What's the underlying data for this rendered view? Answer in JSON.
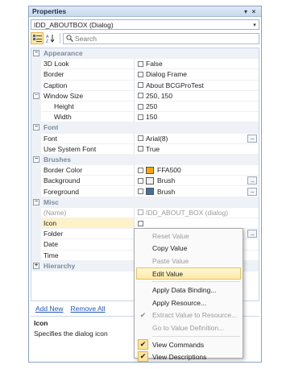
{
  "window": {
    "title": "Properties",
    "pin_glyph": "▾",
    "close_glyph": "×"
  },
  "object_combo": {
    "value": "IDD_ABOUTBOX (Dialog)",
    "arrow": "▾"
  },
  "toolbar": {
    "categorized_glyph": "☷",
    "alphabetical_glyph": "↓",
    "search_placeholder": "Search"
  },
  "grid": {
    "appearance": "Appearance",
    "look3d": {
      "name": "3D Look",
      "value": "False"
    },
    "border": {
      "name": "Border",
      "value": "Dialog Frame"
    },
    "caption": {
      "name": "Caption",
      "value": "About BCGProTest"
    },
    "window_size": {
      "name": "Window Size",
      "value": "250, 150"
    },
    "height": {
      "name": "Height",
      "value": "250"
    },
    "width": {
      "name": "Width",
      "value": "150"
    },
    "font_cat": "Font",
    "font": {
      "name": "Font",
      "value": "Arial(8)"
    },
    "use_system_font": {
      "name": "Use System Font",
      "value": "True"
    },
    "brushes": "Brushes",
    "border_color": {
      "name": "Border Color",
      "value": "FFA500",
      "color": "#FFA500"
    },
    "background": {
      "name": "Background",
      "value": "Brush",
      "color": "#F2F2F2"
    },
    "foreground": {
      "name": "Foreground",
      "value": "Brush",
      "color": "#3F6FA6"
    },
    "misc": "Misc",
    "name_prop": {
      "name": "(Name)",
      "value": "IDD_ABOUT_BOX (dialog)"
    },
    "icon": {
      "name": "Icon"
    },
    "folder": {
      "name": "Folder"
    },
    "date": {
      "name": "Date"
    },
    "time": {
      "name": "Time"
    },
    "hierarchy": "Hierarchy",
    "ellipsis": "..."
  },
  "links": {
    "add_new": "Add New",
    "remove_all": "Remove All"
  },
  "description": {
    "title": "Icon",
    "text": "Specifies the dialog icon"
  },
  "context_menu": {
    "reset_value": "Reset Value",
    "copy_value": "Copy Value",
    "paste_value": "Paste Value",
    "edit_value": "Edit Value",
    "apply_data_binding": "Apply Data Binding...",
    "apply_resource": "Apply Resource...",
    "extract_value": "Extract Value to Resource...",
    "go_to_value_definition": "Go to Value Definition...",
    "view_commands": "View Commands",
    "view_descriptions": "View Descriptions",
    "check_glyph": "✔"
  }
}
